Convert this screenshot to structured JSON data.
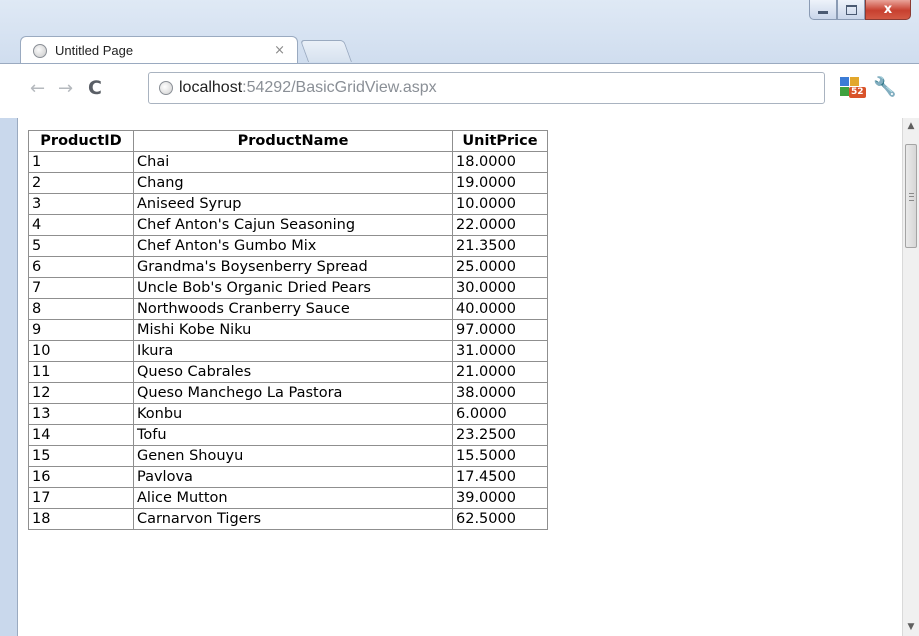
{
  "window": {
    "controls": {
      "close_glyph": "x"
    }
  },
  "tab": {
    "title": "Untitled Page",
    "close_glyph": "×",
    "favicon": "globe-icon"
  },
  "toolbar": {
    "back_glyph": "←",
    "forward_glyph": "→",
    "reload_glyph": "C",
    "url_host": "localhost",
    "url_rest": ":54292/BasicGridView.aspx",
    "extension_badge": "52",
    "wrench_glyph": "🔧"
  },
  "grid": {
    "headers": [
      "ProductID",
      "ProductName",
      "UnitPrice"
    ],
    "rows": [
      [
        "1",
        "Chai",
        "18.0000"
      ],
      [
        "2",
        "Chang",
        "19.0000"
      ],
      [
        "3",
        "Aniseed Syrup",
        "10.0000"
      ],
      [
        "4",
        "Chef Anton's Cajun Seasoning",
        "22.0000"
      ],
      [
        "5",
        "Chef Anton's Gumbo Mix",
        "21.3500"
      ],
      [
        "6",
        "Grandma's Boysenberry Spread",
        "25.0000"
      ],
      [
        "7",
        "Uncle Bob's Organic Dried Pears",
        "30.0000"
      ],
      [
        "8",
        "Northwoods Cranberry Sauce",
        "40.0000"
      ],
      [
        "9",
        "Mishi Kobe Niku",
        "97.0000"
      ],
      [
        "10",
        "Ikura",
        "31.0000"
      ],
      [
        "11",
        "Queso Cabrales",
        "21.0000"
      ],
      [
        "12",
        "Queso Manchego La Pastora",
        "38.0000"
      ],
      [
        "13",
        "Konbu",
        "6.0000"
      ],
      [
        "14",
        "Tofu",
        "23.2500"
      ],
      [
        "15",
        "Genen Shouyu",
        "15.5000"
      ],
      [
        "16",
        "Pavlova",
        "17.4500"
      ],
      [
        "17",
        "Alice Mutton",
        "39.0000"
      ],
      [
        "18",
        "Carnarvon Tigers",
        "62.5000"
      ]
    ]
  },
  "scrollbar": {
    "up_glyph": "▲",
    "down_glyph": "▼"
  }
}
